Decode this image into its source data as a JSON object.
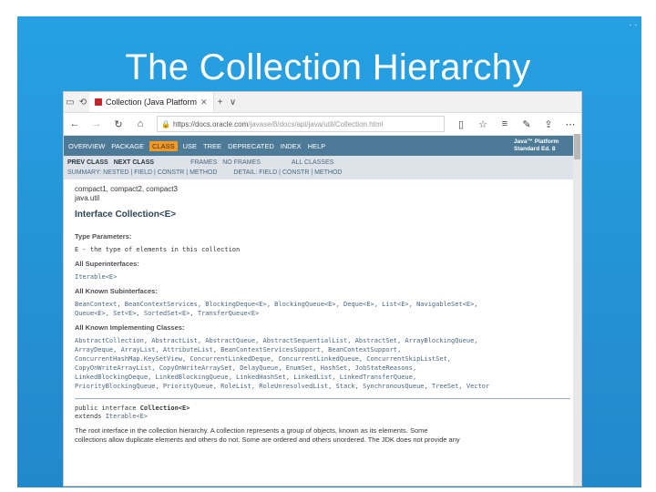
{
  "slide": {
    "title": "The Collection Hierarchy",
    "background": "#2596d8"
  },
  "browser": {
    "tab_title": "Collection (Java Platform",
    "new_tab": "+",
    "dropdown": "∨",
    "url_host": "https://docs.oracle.com",
    "url_path": "/javase/8/docs/api/java/util/Collection.html"
  },
  "javadoc": {
    "topnav": [
      "OVERVIEW",
      "PACKAGE",
      "CLASS",
      "USE",
      "TREE",
      "DEPRECATED",
      "INDEX",
      "HELP"
    ],
    "active_nav": "CLASS",
    "brand_line1": "Java™ Platform",
    "brand_line2": "Standard Ed. 8",
    "subnav_row1": [
      "PREV CLASS",
      "NEXT CLASS",
      "FRAMES",
      "NO FRAMES",
      "ALL CLASSES"
    ],
    "subnav_row2a": "SUMMARY: NESTED | FIELD | CONSTR | METHOD",
    "subnav_row2b": "DETAIL: FIELD | CONSTR | METHOD",
    "profiles": "compact1, compact2, compact3",
    "package": "java.util",
    "heading": "Interface Collection<E>",
    "type_params_label": "Type Parameters:",
    "type_params_value": "E - the type of elements in this collection",
    "superinterfaces_label": "All Superinterfaces:",
    "superinterfaces_value": "Iterable<E>",
    "subinterfaces_label": "All Known Subinterfaces:",
    "subinterfaces_line1": "BeanContext, BeanContextServices, BlockingDeque<E>, BlockingQueue<E>, Deque<E>, List<E>, NavigableSet<E>,",
    "subinterfaces_line2": "Queue<E>, Set<E>, SortedSet<E>, TransferQueue<E>",
    "impl_label": "All Known Implementing Classes:",
    "impl_lines": [
      "AbstractCollection, AbstractList, AbstractQueue, AbstractSequentialList, AbstractSet, ArrayBlockingQueue,",
      "ArrayDeque, ArrayList, AttributeList, BeanContextServicesSupport, BeanContextSupport,",
      "ConcurrentHashMap.KeySetView, ConcurrentLinkedDeque, ConcurrentLinkedQueue, ConcurrentSkipListSet,",
      "CopyOnWriteArrayList, CopyOnWriteArraySet, DelayQueue, EnumSet, HashSet, JobStateReasons,",
      "LinkedBlockingDeque, LinkedBlockingQueue, LinkedHashSet, LinkedList, LinkedTransferQueue,",
      "PriorityBlockingQueue, PriorityQueue, RoleList, RoleUnresolvedList, Stack, SynchronousQueue, TreeSet, Vector"
    ],
    "decl_line1_a": "public interface ",
    "decl_line1_b": "Collection<E>",
    "decl_line2_a": "extends ",
    "decl_line2_b": "Iterable<E>",
    "desc_line1": "The root interface in the collection hierarchy. A collection represents a group of objects, known as its elements. Some",
    "desc_line2": "collections allow duplicate elements and others do not. Some are ordered and others unordered. The JDK does not provide any"
  }
}
